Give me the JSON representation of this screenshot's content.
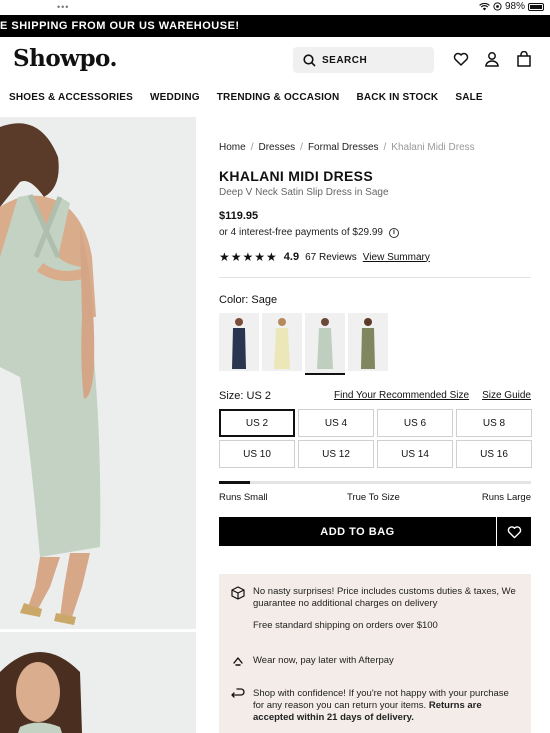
{
  "status": {
    "battery": "98%"
  },
  "promo": {
    "text": "E SHIPPING FROM OUR US WAREHOUSE!"
  },
  "header": {
    "logo": "Showpo.",
    "search_label": "SEARCH"
  },
  "nav": [
    "SHOES & ACCESSORIES",
    "WEDDING",
    "TRENDING & OCCASION",
    "BACK IN STOCK",
    "SALE"
  ],
  "breadcrumb": {
    "home": "Home",
    "dresses": "Dresses",
    "formal": "Formal Dresses",
    "current": "Khalani Midi Dress"
  },
  "product": {
    "title": "KHALANI MIDI DRESS",
    "subtitle": "Deep V Neck Satin Slip Dress in Sage",
    "price": "$119.95",
    "afterpay": "or 4 interest-free payments of $29.99",
    "stars": "★★★★★",
    "rating": "4.9",
    "reviews": "67 Reviews",
    "view_summary": "View Summary"
  },
  "color": {
    "label": "Color:",
    "value": "Sage",
    "selected_index": 2,
    "swatches": [
      {
        "name": "Navy",
        "color": "#2a3550"
      },
      {
        "name": "Lemon",
        "color": "#ece7b8"
      },
      {
        "name": "Sage",
        "color": "#bfcfbf"
      },
      {
        "name": "Olive",
        "color": "#7f8660"
      }
    ]
  },
  "size": {
    "label": "Size:",
    "value": "US 2",
    "find_link": "Find Your Recommended Size",
    "guide_link": "Size Guide",
    "options": [
      "US 2",
      "US 4",
      "US 6",
      "US 8",
      "US 10",
      "US 12",
      "US 14",
      "US 16"
    ],
    "selected": "US 2"
  },
  "fit": {
    "small": "Runs Small",
    "true": "True To Size",
    "large": "Runs Large",
    "level": 0.1
  },
  "actions": {
    "add_to_bag": "ADD TO BAG"
  },
  "notes": {
    "customs": "No nasty surprises! Price includes customs duties & taxes, We guarantee no additional charges on delivery",
    "shipping": "Free standard shipping on orders over $100",
    "afterpay": "Wear now, pay later with Afterpay",
    "returns": "Shop with confidence! If you're not happy with your purchase for any reason you can return your items.",
    "returns_bold": "Returns are accepted within 21 days of delivery."
  },
  "colors": {
    "accent": "#000000",
    "panel": "#f3ece8",
    "dress": "#bfcfbf"
  }
}
